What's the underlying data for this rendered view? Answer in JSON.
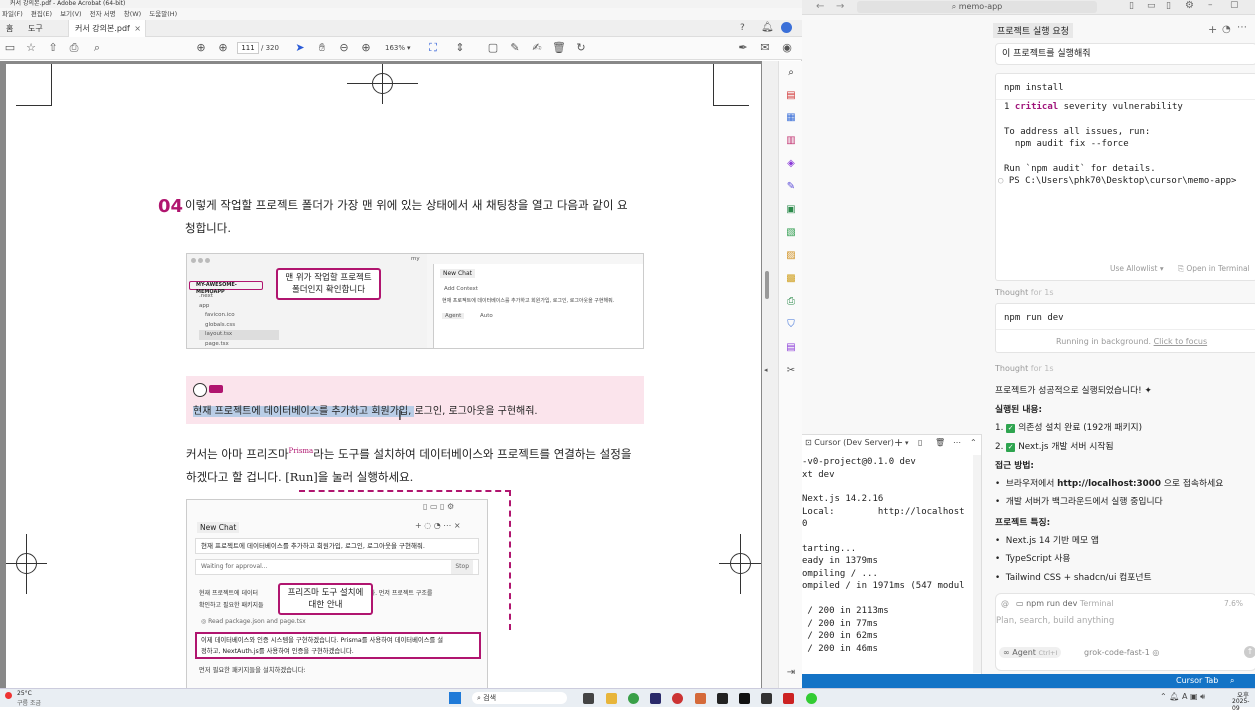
{
  "acrobat": {
    "title": "커서 강의본.pdf - Adobe Acrobat (64-bit)",
    "menu": [
      "파일(F)",
      "편집(E)",
      "보기(V)",
      "전자 서명",
      "창(W)",
      "도움말(H)"
    ],
    "tabs": {
      "home": "홈",
      "tools": "도구",
      "document": "커서 강의본.pdf"
    },
    "page_current": "111",
    "page_total": "/ 320",
    "zoom": "163%",
    "content": {
      "step_number": "04",
      "step_text_line1": "이렇게 작업할 프로젝트 폴더가 가장 맨 위에 있는 상태에서 새 채팅창을 열고 다음과 같이 요",
      "step_text_line2": "청합니다.",
      "fig1": {
        "callout": "맨 위가 작업할 프로젝트\n폴더인지 확인합니다",
        "folder_name": "MY-AWESOME-MEMOAPP",
        "files": [
          ".next",
          "app",
          "favicon.ico",
          "globals.css",
          "layout.tsx",
          "page.tsx"
        ],
        "chat_title": "New Chat",
        "add_context": "Add Context",
        "chat_prompt": "현재 프로젝트에 데이터베이스를 추가하고 회원가입, 로그인, 로그아웃을 구현해줘.",
        "agent": "Agent",
        "auto": "Auto",
        "header_right": "my"
      },
      "prompt_selected": "현재 프로젝트에 데이터베이스를 추가하고 회원가입, ",
      "prompt_rest": "로그인, 로그아웃을 구현해줘.",
      "para2_line1_a": "커서는 아마 프리즈마",
      "para2_prisma": "Prisma",
      "para2_line1_b": "라는 도구를 설치하여 데이터베이스와 프로젝트를 연결하는 설정을",
      "para2_line2": "하겠다고 할 겁니다. [Run]을 눌러 실행하세요.",
      "fig2": {
        "chat_title": "New Chat",
        "prompt": "현재 프로젝트에 데이터베이스를 추가하고 회원가입, 로그인, 로그아웃을 구현해줘.",
        "waiting": "Waiting for approval...",
        "stop": "Stop",
        "callout": "프리즈마 도구 설치에\n대한 안내",
        "line_a": "현재 프로젝트에 데이터",
        "line_a_end": "겠습니다. 먼저 프로젝트 구조를",
        "line_b": "확인하고 필요한 패키지들",
        "read_files": "Read package.json and page.tsx",
        "hl_line1": "이제 데이터베이스와 인증 시스템을 구현하겠습니다. Prisma를 사용하여 데이터베이스를 설",
        "hl_line2": "정하고, NextAuth.js를 사용하여 인증을 구현하겠습니다.",
        "last_line": "먼저 필요한 패키지들을 설치하겠습니다:"
      }
    }
  },
  "cursor": {
    "search": "memo-app",
    "panel_title": "프로젝트 실행 요청",
    "user_message": "이 프로젝트를 실행해줘",
    "cmd1": "npm install",
    "cmd1_output": [
      {
        "pre": "1 ",
        "crit": "critical",
        "post": " severity vulnerability"
      },
      {
        "pre": "",
        "crit": "",
        "post": ""
      },
      {
        "pre": "To address all issues, run:",
        "crit": "",
        "post": ""
      },
      {
        "pre": "  npm audit fix --force",
        "crit": "",
        "post": ""
      },
      {
        "pre": "",
        "crit": "",
        "post": ""
      },
      {
        "pre": "Run `npm audit` for details.",
        "crit": "",
        "post": ""
      },
      {
        "pre": "PS C:\\Users\\phk70\\Desktop\\cursor\\memo-app>",
        "crit": "",
        "post": ""
      }
    ],
    "use_allowlist": "Use Allowlist",
    "open_in_terminal": "Open in Terminal",
    "thought1_a": "Thought",
    "thought1_b": "for 1s",
    "cmd2": "npm run dev",
    "running_bg": "Running in background.",
    "click_focus": "Click to focus",
    "thought2_a": "Thought",
    "thought2_b": "for 1s",
    "success": "프로젝트가 성공적으로 실행되었습니다!",
    "executed_heading": "실행된 내용:",
    "executed_items": [
      "의존성 설치 완료 (192개 패키지)",
      "Next.js 개발 서버 시작됨"
    ],
    "access_heading": "접근 방법:",
    "access_items_a": "브라우저에서 ",
    "access_url": "http://localhost:3000",
    "access_items_b": " 으로 접속하세요",
    "access_item2": "개발 서버가 백그라운드에서 실행 중입니다",
    "features_heading": "프로젝트 특징:",
    "features": [
      "Next.js 14 기반 메모 앱",
      "TypeScript 사용",
      "Tailwind CSS + shadcn/ui 컴포넌트"
    ],
    "input_context": "npm run dev",
    "input_context_tag": "Terminal",
    "input_pct": "7.6%",
    "input_placeholder": "Plan, search, build anything",
    "agent_label": "Agent",
    "agent_shortcut": "Ctrl+I",
    "model": "grok-code-fast-1",
    "terminal_title": "Cursor (Dev Server)",
    "terminal_lines": [
      "-v0-project@0.1.0 dev",
      "xt dev",
      "",
      "Next.js 14.2.16",
      "Local:        http://localhost",
      "0",
      "",
      "tarting...",
      "eady in 1379ms",
      "ompiling / ...",
      "ompiled / in 1971ms (547 modul",
      "",
      " / 200 in 2113ms",
      " / 200 in 77ms",
      " / 200 in 62ms",
      " / 200 in 46ms"
    ],
    "status_right": "Cursor Tab"
  },
  "taskbar": {
    "temp": "25°C",
    "weather": "구름 조금",
    "search": "검색",
    "clock_time": "오후",
    "clock_date": "2025-09"
  },
  "colors": {
    "accent_magenta": "#b0156f",
    "selection": "#b9cde6",
    "prompt_bg": "#fbe4ec",
    "status_blue": "#1473c6"
  }
}
